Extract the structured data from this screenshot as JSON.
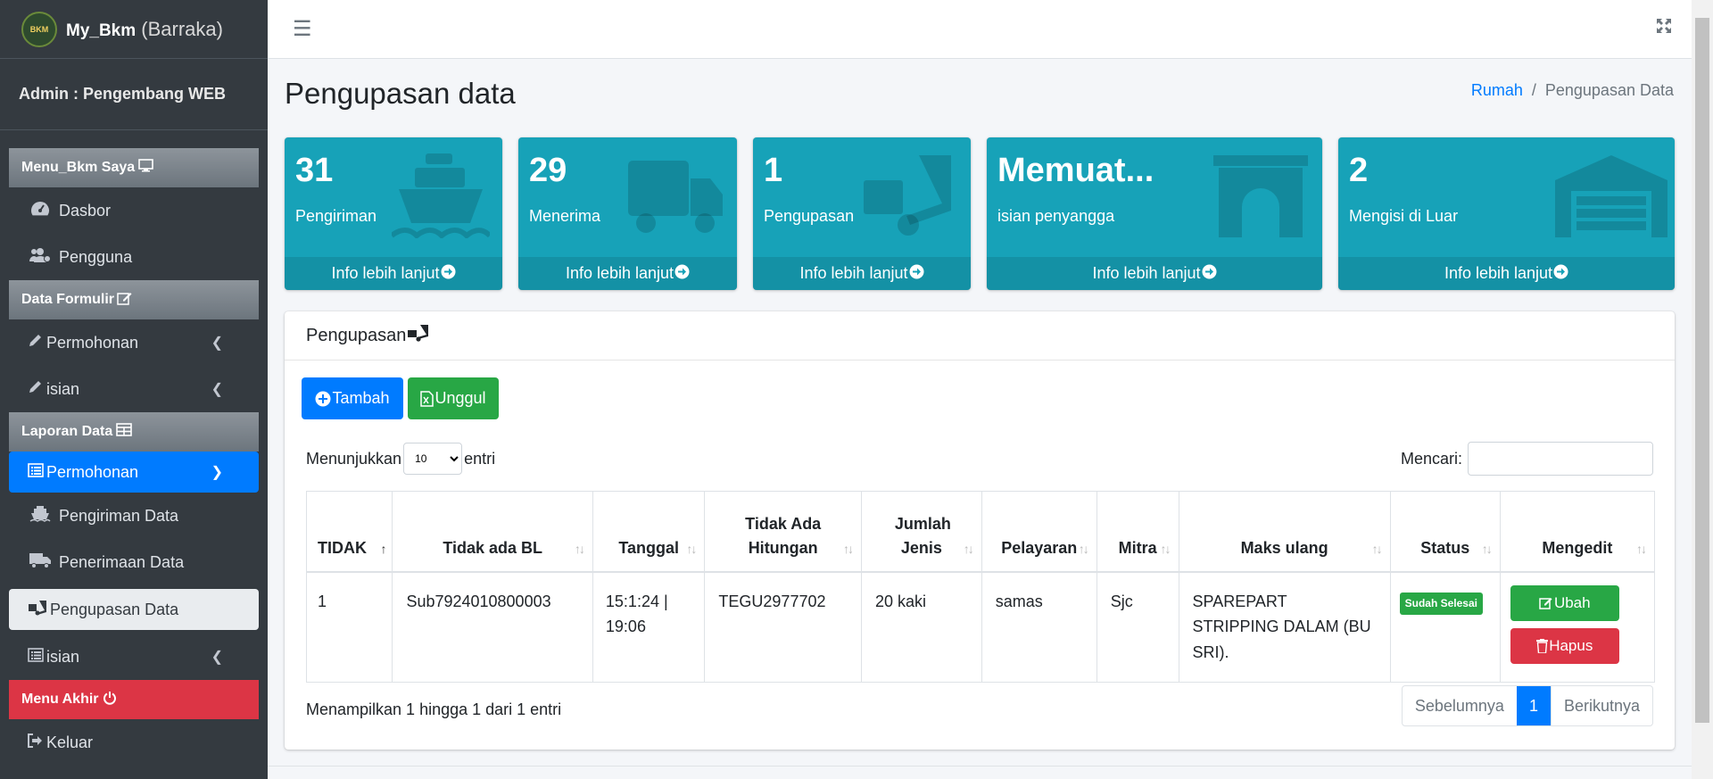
{
  "brand": {
    "name": "My_Bkm",
    "suffix": "(Barraka)",
    "logo_text": "BKM"
  },
  "admin_label": "Admin : Pengembang WEB",
  "sidebar": {
    "h1": "Menu_Bkm Saya",
    "dasbor": "Dasbor",
    "pengguna": "Pengguna",
    "h2": "Data Formulir",
    "permohonan1": "Permohonan",
    "isian1": "isian",
    "h3": "Laporan Data",
    "permohonan2": "Permohonan",
    "pengiriman": "Pengiriman Data",
    "penerimaan": "Penerimaan Data",
    "pengupasan": "Pengupasan Data",
    "isian2": "isian",
    "h4": "Menu Akhir",
    "keluar": "Keluar"
  },
  "page": {
    "title": "Pengupasan data"
  },
  "breadcrumb": {
    "home": "Rumah",
    "sep": "/",
    "current": "Pengupasan Data"
  },
  "boxes": [
    {
      "num": "31",
      "label": "Pengiriman",
      "icon": "ship-icon",
      "footer": "Info lebih lanjut"
    },
    {
      "num": "29",
      "label": "Menerima",
      "icon": "truck-icon",
      "footer": "Info lebih lanjut"
    },
    {
      "num": "1",
      "label": "Pengupasan",
      "icon": "dolly-icon",
      "footer": "Info lebih lanjut"
    },
    {
      "num": "Memuat...",
      "label": "isian penyangga",
      "icon": "archway-icon",
      "footer": "Info lebih lanjut"
    },
    {
      "num": "2",
      "label": "Mengisi di Luar",
      "icon": "warehouse-icon",
      "footer": "Info lebih lanjut"
    }
  ],
  "card": {
    "title": "Pengupasan",
    "add": "Tambah",
    "upload": "Unggul",
    "show_pre": "Menunjukkan",
    "show_value": "10",
    "show_post": "entri",
    "search_label": "Mencari:",
    "search_value": ""
  },
  "table": {
    "headers": [
      "TIDAK",
      "Tidak ada BL",
      "Tanggal",
      "Tidak Ada Hitungan",
      "Jumlah Jenis",
      "Pelayaran",
      "Mitra",
      "Maks ulang",
      "Status",
      "Mengedit"
    ],
    "row": {
      "no": "1",
      "bl": "Sub7924010800003",
      "tanggal": "15:1:24 | 19:06",
      "hitungan": "TEGU2977702",
      "jenis": "20 kaki",
      "pelayaran": "samas",
      "mitra": "Sjc",
      "maks": "SPAREPART STRIPPING DALAM (BU SRI).",
      "status": "Sudah Selesai",
      "edit": "Ubah",
      "delete": "Hapus"
    }
  },
  "footer": {
    "info": "Menampilkan 1 hingga 1 dari 1 entri",
    "prev": "Sebelumnya",
    "page": "1",
    "next": "Berikutnya"
  },
  "colors": {
    "teal": "#17a2b8",
    "blue": "#007bff",
    "green": "#28a745",
    "red": "#dc3545",
    "sidebar": "#343a40"
  }
}
